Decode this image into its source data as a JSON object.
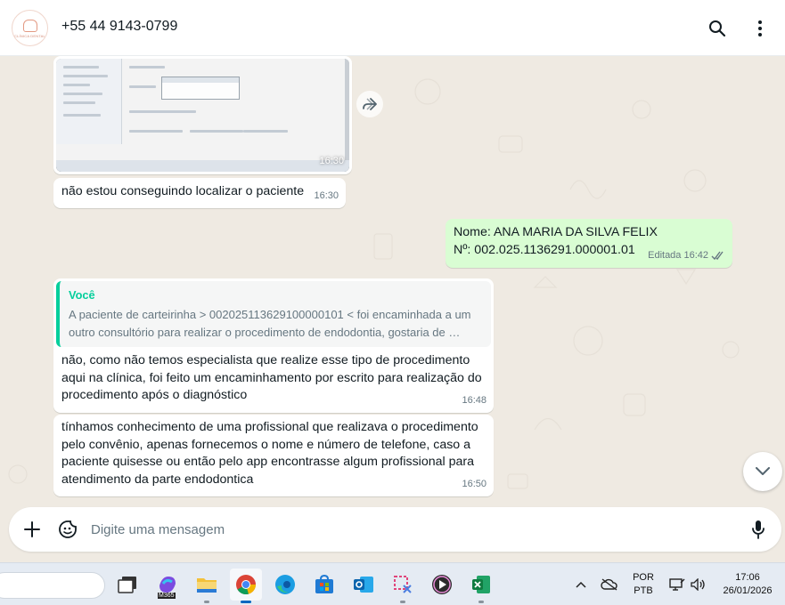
{
  "header": {
    "contact_name": "+55 44 9143-0799",
    "avatar_brand": "CLÍNICA DENTAL"
  },
  "messages": {
    "image": {
      "time": "16:30"
    },
    "m1": {
      "text": "não estou conseguindo localizar o paciente",
      "time": "16:30"
    },
    "m2": {
      "line1": "Nome: ANA MARIA DA SILVA FELIX",
      "line2": "Nº: 002.025.1136291.000001.01",
      "status": "Editada 16:42"
    },
    "m3": {
      "quote_author": "Você",
      "quote_text": "A paciente de carteirinha > 0020251136291000001​01 < foi encaminhada a um outro consultório para realizar o procedimento de endodontia, gostaria de …",
      "text": "não, como não temos especialista que realize esse tipo de procedimento aqui na clínica, foi feito um encaminhamento por escrito para realização do procedimento após o diagnóstico",
      "time": "16:48"
    },
    "m4": {
      "text": "tínhamos conhecimento de uma profissional que realizava o procedimento pelo convênio, apenas fornecemos o nome e número de telefone, caso a paciente quisesse ou então pelo app encontrasse algum profissional para atendimento da parte endodontica",
      "time": "16:50"
    }
  },
  "composer": {
    "placeholder": "Digite uma mensagem"
  },
  "taskbar": {
    "lang_line1": "POR",
    "lang_line2": "PTB",
    "clock_time": "17:06",
    "clock_date": "26/01/2026",
    "m365_label": "M365"
  },
  "colors": {
    "outgoing": "#d9fdd3",
    "incoming": "#ffffff",
    "accent": "#06cf9c",
    "read_tick": "#53bdeb"
  },
  "icons": [
    "search-icon",
    "kebab-menu-icon",
    "forward-icon",
    "chevron-down-icon",
    "plus-icon",
    "sticker-icon",
    "mic-icon",
    "double-check-icon"
  ]
}
